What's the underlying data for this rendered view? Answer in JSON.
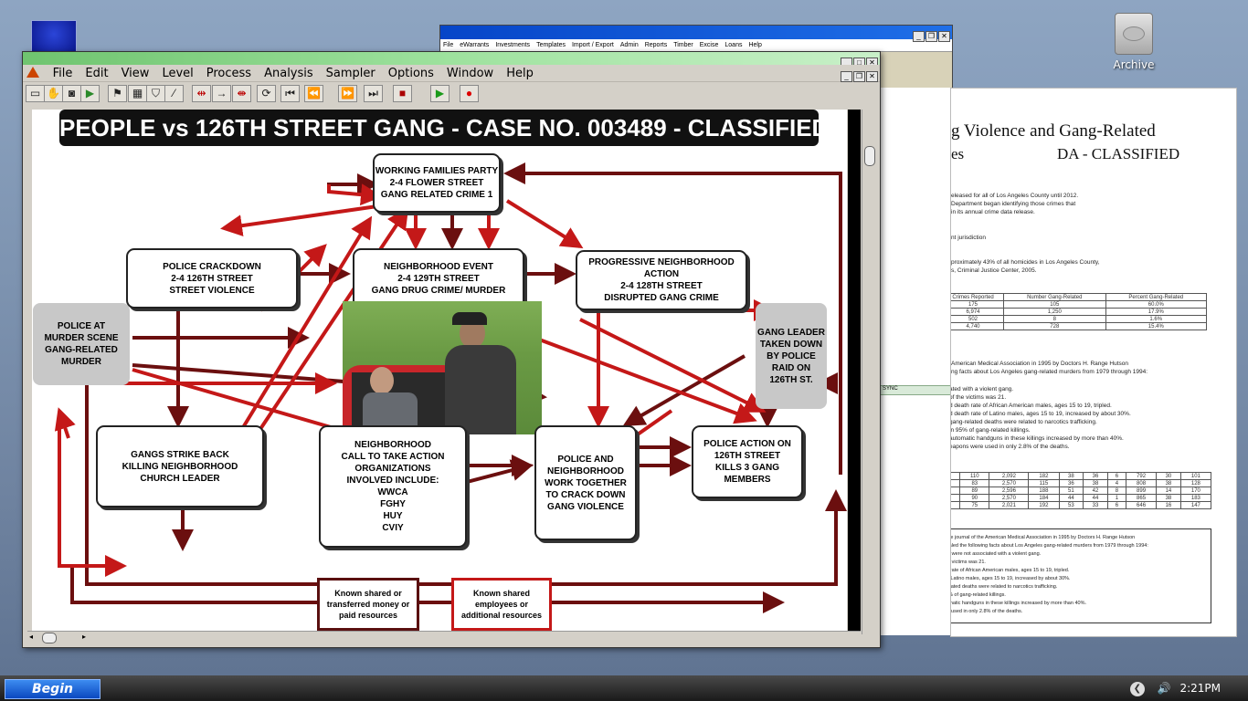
{
  "desktop": {
    "archive_label": "Archive"
  },
  "back_window": {
    "menu": [
      "File",
      "eWarrants",
      "Investments",
      "Templates",
      "Import / Export",
      "Admin",
      "Reports",
      "Timber",
      "Excise",
      "Loans",
      "Help"
    ],
    "sync_label": "SYNC"
  },
  "document": {
    "title_line1": "g Violence and Gang-Related",
    "title_line2": "es",
    "classified": "DA - CLASSIFIED",
    "para1": [
      "eleased for all of Los Angeles County until 2012.",
      "Department began identifying those crimes that",
      "in its annual crime data release."
    ],
    "para2": "nt jurisdiction",
    "para3": [
      "proximately 43% of all homicides in Los Angeles County,",
      "s, Criminal Justice Center, 2005."
    ],
    "table_headers": [
      "Crimes Reported",
      "Number Gang-Related",
      "Percent Gang-Related"
    ],
    "table_rows": [
      [
        "175",
        "105",
        "60.0%"
      ],
      [
        "6,974",
        "1,250",
        "17.9%"
      ],
      [
        "502",
        "8",
        "1.6%"
      ],
      [
        "4,740",
        "728",
        "15.4%"
      ]
    ],
    "para4": [
      "American Medical Association in 1995 by Doctors H. Range Hutson",
      "ng facts about Los Angeles gang-related murders from 1979 through 1994:"
    ],
    "bullets": [
      "ated with a violent gang.",
      "of the victims was 21.",
      "d death rate of African American males, ages 15 to 19, tripled.",
      "d death rate of Latino males, ages 15 to 19, increased by about 30%.",
      "gang-related deaths were related to narcotics trafficking.",
      "in 95% of gang-related killings.",
      "automatic handguns in these killings increased by more than 40%.",
      "eapons were used in only 2.8% of the deaths."
    ],
    "table2_rows": [
      [
        "197",
        "---",
        "2,873",
        "110",
        "2,092",
        "182",
        "38",
        "36",
        "6",
        "792",
        "30",
        "101"
      ],
      [
        "185",
        "---",
        "2,844",
        "83",
        "2,570",
        "115",
        "36",
        "38",
        "4",
        "808",
        "38",
        "128"
      ],
      [
        "208",
        "---",
        "3,363",
        "89",
        "2,596",
        "188",
        "51",
        "42",
        "8",
        "899",
        "14",
        "170"
      ],
      [
        "200",
        "---",
        "3,635",
        "90",
        "2,570",
        "184",
        "44",
        "44",
        "1",
        "865",
        "38",
        "183"
      ],
      [
        "200",
        "580",
        "2,636",
        "75",
        "2,021",
        "192",
        "53",
        "33",
        "6",
        "646",
        "16",
        "147"
      ]
    ],
    "box_lines": [
      "ublished in the journal of the American Medical Association in 1995 by Doctors H. Range Hutson",
      "e Anglo revealed the following facts about Los Angeles gang-related murders from 1979 through 1994:",
      "of the victims were not associated with a violent gang.",
      "an age of the victims was 21.",
      "elated death rate of African American males, ages 15 to 19, tripled.",
      "death rate of Latino males, ages 15 to 19, increased by about 30%.",
      "% of gang-related deaths were related to narcotics trafficking.",
      "e used in 95% of gang-related killings.",
      "of semi-automatic handguns in these killings increased by more than 40%.",
      "eapons were used in only 2.8% of the deaths."
    ]
  },
  "main_window": {
    "menu": [
      "File",
      "Edit",
      "View",
      "Level",
      "Process",
      "Analysis",
      "Sampler",
      "Options",
      "Window",
      "Help"
    ]
  },
  "diagram": {
    "banner": "PEOPLE vs 126TH STREET GANG - CASE NO. 003489 - CLASSIFIED",
    "nodes": {
      "working_families": [
        "WORKING FAMILIES PARTY",
        "2-4 FLOWER STREET",
        "GANG RELATED CRIME 1"
      ],
      "police_crackdown": [
        "POLICE CRACKDOWN",
        "2-4 126TH STREET",
        "STREET VIOLENCE"
      ],
      "neighborhood_event": [
        "NEIGHBORHOOD EVENT",
        "2-4 129TH STREET",
        "GANG DRUG CRIME/ MURDER"
      ],
      "progressive_action": [
        "PROGRESSIVE NEIGHBORHOOD ACTION",
        "2-4 128TH STREET",
        "DISRUPTED GANG CRIME"
      ],
      "police_murder_scene": [
        "POLICE AT",
        "MURDER SCENE",
        "GANG-RELATED",
        "MURDER"
      ],
      "gang_leader": [
        "GANG LEADER",
        "TAKEN DOWN",
        "BY POLICE",
        "RAID ON",
        "126TH ST."
      ],
      "gangs_strike_back": [
        "GANGS STRIKE BACK",
        "KILLING NEIGHBORHOOD",
        "CHURCH LEADER"
      ],
      "call_to_action": [
        "NEIGHBORHOOD",
        "CALL TO TAKE ACTION",
        "ORGANIZATIONS",
        "INVOLVED INCLUDE:",
        "WWCA",
        "FGHY",
        "HUY",
        "CVIY"
      ],
      "police_neighborhood": [
        "POLICE AND",
        "NEIGHBORHOOD",
        "WORK TOGETHER",
        "TO CRACK DOWN",
        "GANG VIOLENCE"
      ],
      "police_action": [
        "POLICE ACTION ON",
        "126TH STREET",
        "KILLS 3 GANG MEMBERS"
      ]
    },
    "legend": {
      "money": [
        "Known shared or",
        "transferred money or",
        "paid resources"
      ],
      "employees": [
        "Known shared",
        "employees or",
        "additional resources"
      ]
    },
    "colors": {
      "dark_red": "#6b0f0f",
      "red": "#c41818",
      "banner": "#111111"
    }
  },
  "taskbar": {
    "start_label": "Begin",
    "clock": "2:21PM"
  }
}
